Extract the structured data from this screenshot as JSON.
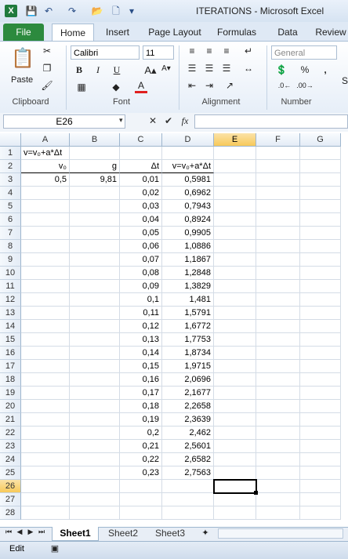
{
  "window": {
    "title": "ITERATIONS  -  Microsoft Excel"
  },
  "app_icon": "X",
  "ribbon": {
    "tabs": [
      "File",
      "Home",
      "Insert",
      "Page Layout",
      "Formulas",
      "Data",
      "Review"
    ],
    "active_tab": "Home",
    "clipboard": {
      "paste_label": "Paste",
      "group_label": "Clipboard"
    },
    "font": {
      "name": "Calibri",
      "size": "11",
      "group_label": "Font",
      "bold": "B",
      "italic": "I",
      "underline": "U"
    },
    "alignment": {
      "group_label": "Alignment"
    },
    "number": {
      "format": "General",
      "group_label": "Number",
      "percent": "%",
      "comma": ","
    },
    "styles": {
      "label_partial": "S"
    }
  },
  "formula_bar": {
    "name_box": "E26",
    "fx_label": "fx",
    "value": ""
  },
  "columns": [
    "A",
    "B",
    "C",
    "D",
    "E",
    "F",
    "G"
  ],
  "rows": [
    [
      "v=v₀+a*Δt",
      "",
      "",
      "",
      "",
      "",
      ""
    ],
    [
      "v₀",
      "g",
      "Δt",
      "v=v₀+a*Δt",
      "",
      "",
      ""
    ],
    [
      "0,5",
      "9,81",
      "0,01",
      "0,5981",
      "",
      "",
      ""
    ],
    [
      "",
      "",
      "0,02",
      "0,6962",
      "",
      "",
      ""
    ],
    [
      "",
      "",
      "0,03",
      "0,7943",
      "",
      "",
      ""
    ],
    [
      "",
      "",
      "0,04",
      "0,8924",
      "",
      "",
      ""
    ],
    [
      "",
      "",
      "0,05",
      "0,9905",
      "",
      "",
      ""
    ],
    [
      "",
      "",
      "0,06",
      "1,0886",
      "",
      "",
      ""
    ],
    [
      "",
      "",
      "0,07",
      "1,1867",
      "",
      "",
      ""
    ],
    [
      "",
      "",
      "0,08",
      "1,2848",
      "",
      "",
      ""
    ],
    [
      "",
      "",
      "0,09",
      "1,3829",
      "",
      "",
      ""
    ],
    [
      "",
      "",
      "0,1",
      "1,481",
      "",
      "",
      ""
    ],
    [
      "",
      "",
      "0,11",
      "1,5791",
      "",
      "",
      ""
    ],
    [
      "",
      "",
      "0,12",
      "1,6772",
      "",
      "",
      ""
    ],
    [
      "",
      "",
      "0,13",
      "1,7753",
      "",
      "",
      ""
    ],
    [
      "",
      "",
      "0,14",
      "1,8734",
      "",
      "",
      ""
    ],
    [
      "",
      "",
      "0,15",
      "1,9715",
      "",
      "",
      ""
    ],
    [
      "",
      "",
      "0,16",
      "2,0696",
      "",
      "",
      ""
    ],
    [
      "",
      "",
      "0,17",
      "2,1677",
      "",
      "",
      ""
    ],
    [
      "",
      "",
      "0,18",
      "2,2658",
      "",
      "",
      ""
    ],
    [
      "",
      "",
      "0,19",
      "2,3639",
      "",
      "",
      ""
    ],
    [
      "",
      "",
      "0,2",
      "2,462",
      "",
      "",
      ""
    ],
    [
      "",
      "",
      "0,21",
      "2,5601",
      "",
      "",
      ""
    ],
    [
      "",
      "",
      "0,22",
      "2,6582",
      "",
      "",
      ""
    ],
    [
      "",
      "",
      "0,23",
      "2,7563",
      "",
      "",
      ""
    ],
    [
      "",
      "",
      "",
      "",
      "",
      "",
      ""
    ],
    [
      "",
      "",
      "",
      "",
      "",
      "",
      ""
    ],
    [
      "",
      "",
      "",
      "",
      "",
      "",
      ""
    ]
  ],
  "active_cell": {
    "col": "E",
    "row": 26
  },
  "sheets": [
    "Sheet1",
    "Sheet2",
    "Sheet3"
  ],
  "active_sheet": "Sheet1",
  "status": {
    "mode": "Edit"
  }
}
